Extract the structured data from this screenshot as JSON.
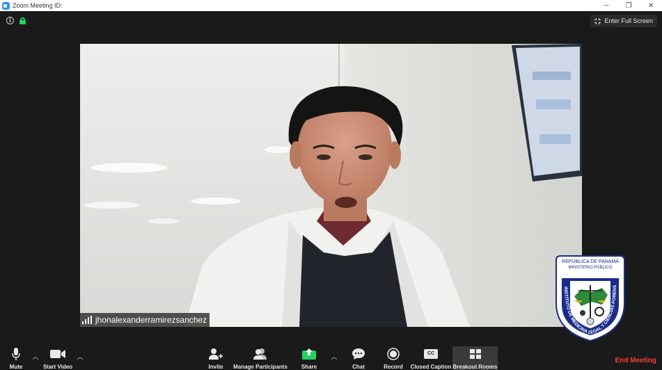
{
  "window": {
    "title": "Zoom Meeting ID:",
    "minimize": "─",
    "restore": "❐",
    "close": "✕"
  },
  "meeting": {
    "fullscreen_label": "Enter Full Screen",
    "participant_name": "jhonalexanderramirezsanchez",
    "lock_color": "#23d160"
  },
  "logo": {
    "top_line_1": "REPÚBLICA DE PANAMÁ",
    "top_line_2": "MINISTERIO PÚBLICO",
    "ring_text": "INSTITUTO DE MEDICINA LEGAL Y CIENCIAS FORENSES"
  },
  "toolbar": {
    "mute": "Mute",
    "start_video": "Start Video",
    "invite": "Invite",
    "manage_participants": "Manage Participants",
    "share": "Share",
    "chat": "Chat",
    "record": "Record",
    "closed_caption": "Closed Caption",
    "cc_glyph": "CC",
    "breakout_rooms": "Breakout Rooms",
    "end_meeting": "End Meeting",
    "share_color": "#23d160",
    "end_color": "#ff3b3b"
  }
}
